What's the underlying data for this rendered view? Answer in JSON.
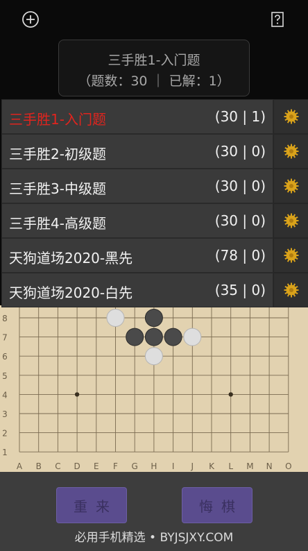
{
  "header": {
    "add_icon": "plus-circle-icon",
    "help_icon": "question-box-icon"
  },
  "title_box": {
    "title": "三手胜1-入门题",
    "stats": "（题数：30  ｜  已解：1）"
  },
  "dropdown": {
    "items": [
      {
        "name": "三手胜1-入门题",
        "count": "(30 | 1)",
        "active": true
      },
      {
        "name": "三手胜2-初级题",
        "count": "(30 | 0)",
        "active": false
      },
      {
        "name": "三手胜3-中级题",
        "count": "(30 | 0)",
        "active": false
      },
      {
        "name": "三手胜4-高级题",
        "count": "(30 | 0)",
        "active": false
      },
      {
        "name": "天狗道场2020-黑先",
        "count": "(78 | 0)",
        "active": false
      },
      {
        "name": "天狗道场2020-白先",
        "count": "(35 | 0)",
        "active": false
      }
    ],
    "active_color": "#e0241e",
    "gear_color": "#d9a21b"
  },
  "board": {
    "columns": [
      "A",
      "B",
      "C",
      "D",
      "E",
      "F",
      "G",
      "H",
      "I",
      "J",
      "K",
      "L",
      "M",
      "N",
      "O"
    ],
    "rows": [
      "8",
      "7",
      "6",
      "5",
      "4",
      "3",
      "2",
      "1"
    ],
    "stones": [
      {
        "col": "F",
        "row": "8",
        "color": "white"
      },
      {
        "col": "H",
        "row": "8",
        "color": "black"
      },
      {
        "col": "G",
        "row": "7",
        "color": "black"
      },
      {
        "col": "H",
        "row": "7",
        "color": "black"
      },
      {
        "col": "I",
        "row": "7",
        "color": "black"
      },
      {
        "col": "J",
        "row": "7",
        "color": "white"
      },
      {
        "col": "H",
        "row": "6",
        "color": "white"
      }
    ],
    "star_points": [
      {
        "col": "D",
        "row": "4"
      },
      {
        "col": "L",
        "row": "4"
      }
    ]
  },
  "buttons": {
    "restart": "重来",
    "undo": "悔棋"
  },
  "footer": "必用手机精选 • BYJSJXY.COM"
}
